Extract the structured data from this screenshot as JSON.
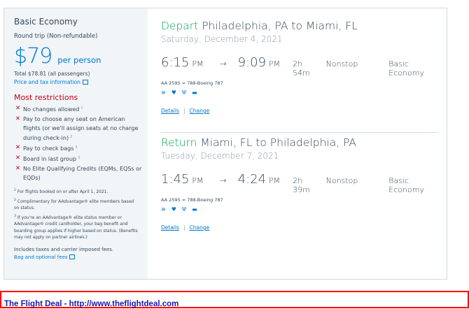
{
  "fare": {
    "cabin": "Basic Economy",
    "trip_type": "Round trip (Non-refundable)",
    "price": "$79",
    "per_person": "per person",
    "total": "Total $78.81 (all passengers)",
    "price_tax_info": "Price and tax information",
    "restrictions_title": "Most restrictions",
    "restrictions": [
      {
        "text": "No changes allowed",
        "note": "1"
      },
      {
        "text": "Pay to choose any seat on American flights (or we'll assign seats at no charge during check-in)",
        "note": "2"
      },
      {
        "text": "Pay to check bags",
        "note": "3"
      },
      {
        "text": "Board in last group",
        "note": "3"
      },
      {
        "text": "No Elite Qualifying Credits (EQMs, EQSs or EQDs)",
        "note": ""
      }
    ],
    "footnotes": [
      {
        "mark": "1",
        "text": "For flights booked on or after April 1, 2021."
      },
      {
        "mark": "2",
        "text": "Complimentary for AAdvantage® elite members based on status."
      },
      {
        "mark": "3",
        "text": "If you're an AAdvantage® elite status member or AAdvantage® credit cardholder, your bag benefit and boarding group applies if higher based on status. (Benefits may not apply on partner airlines.)"
      }
    ],
    "includes": "Includes taxes and carrier imposed fees.",
    "bag_fees": "Bag and optional fees",
    "colors": {
      "accent": "#0078d2",
      "restriction": "#c30019",
      "direction": "#00a651",
      "panel": "#f1f5f8"
    }
  },
  "depart": {
    "label": "Depart",
    "route": "Philadelphia, PA to Miami, FL",
    "date": "Saturday, December 4, 2021",
    "dep_time": "6:15",
    "dep_ampm": "PM",
    "arrow": "→",
    "arr_time": "9:09",
    "arr_ampm": "PM",
    "duration": "2h 54m",
    "stops": "Nonstop",
    "cabin": "Basic Economy",
    "flight": "AA 2595  =  788-Boeing 787",
    "details": "Details",
    "change": "Change"
  },
  "return": {
    "label": "Return",
    "route": "Miami, FL to Philadelphia, PA",
    "date": "Tuesday, December 7, 2021",
    "dep_time": "1:45",
    "dep_ampm": "PM",
    "arrow": "→",
    "arr_time": "4:24",
    "arr_ampm": "PM",
    "duration": "2h 39m",
    "stops": "Nonstop",
    "cabin": "Basic Economy",
    "flight": "AA 2595  =  788-Boeing 787",
    "details": "Details",
    "change": "Change"
  },
  "amenities": [
    "wifi-icon",
    "power-icon",
    "usb-icon",
    "entertainment-icon"
  ],
  "banner": {
    "text": "The Flight Deal - http://www.theflightdeal.com",
    "border_color": "#ff0000",
    "text_color": "#1a1aa8"
  }
}
